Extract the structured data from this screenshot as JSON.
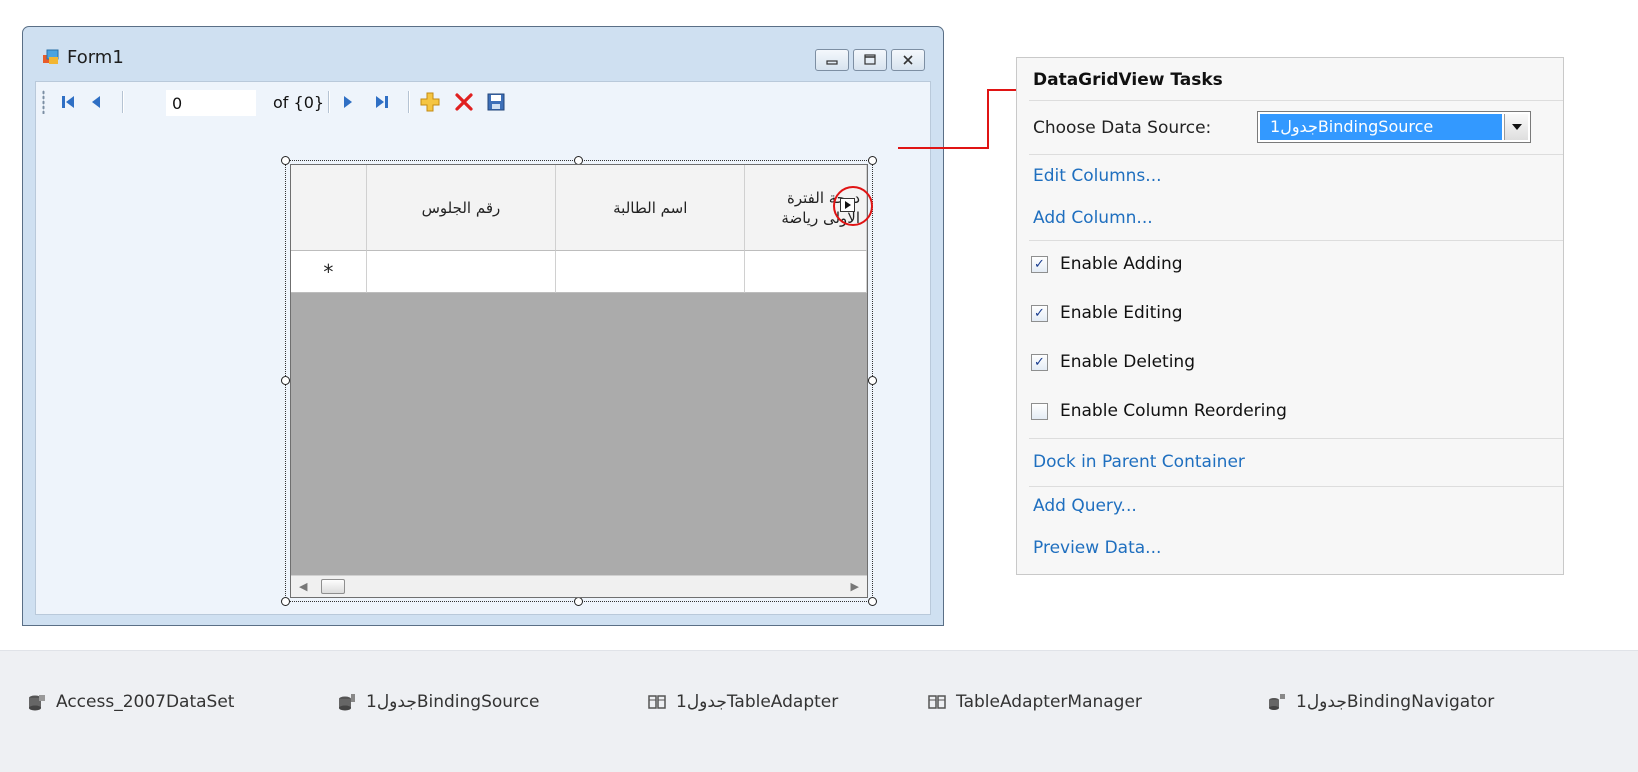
{
  "form": {
    "title": "Form1",
    "navigator": {
      "position": "0",
      "count": "of {0}"
    },
    "grid": {
      "columns": [
        "رقم الجلوس",
        "اسم الطالبة",
        "درجة الفترة الاولى رياضة"
      ],
      "new_row_marker": "*"
    }
  },
  "tasks": {
    "title": "DataGridView Tasks",
    "choose_data_source_label": "Choose Data Source:",
    "data_source_value": "جدول1BindingSource",
    "links": {
      "edit_columns": "Edit Columns...",
      "add_column": "Add Column...",
      "dock": "Dock in Parent Container",
      "add_query": "Add Query...",
      "preview_data": "Preview Data..."
    },
    "checks": [
      {
        "label": "Enable Adding",
        "checked": true
      },
      {
        "label": "Enable Editing",
        "checked": true
      },
      {
        "label": "Enable Deleting",
        "checked": true
      },
      {
        "label": "Enable Column Reordering",
        "checked": false
      }
    ]
  },
  "tray": [
    {
      "label": "Access_2007DataSet",
      "icon": "dataset-icon"
    },
    {
      "label": "جدول1BindingSource",
      "icon": "binding-source-icon"
    },
    {
      "label": "جدول1TableAdapter",
      "icon": "table-adapter-icon"
    },
    {
      "label": "TableAdapterManager",
      "icon": "table-adapter-manager-icon"
    },
    {
      "label": "جدول1BindingNavigator",
      "icon": "binding-navigator-icon"
    }
  ],
  "colors": {
    "selection": "#3399ff",
    "link": "#1f6fbf",
    "callout": "#e01414"
  }
}
